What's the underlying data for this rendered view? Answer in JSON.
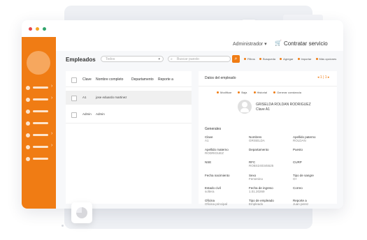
{
  "header": {
    "user": "Administrador",
    "cta": "Contratar servicio"
  },
  "sidebar": {
    "items": [
      {
        "icon": "nav-icon"
      },
      {
        "icon": "nav-icon"
      },
      {
        "icon": "nav-icon"
      },
      {
        "icon": "nav-icon"
      },
      {
        "icon": "nav-icon"
      },
      {
        "icon": "nav-icon"
      },
      {
        "icon": "nav-icon"
      }
    ]
  },
  "main": {
    "title": "Empleados",
    "filter_value": "Todos",
    "search_placeholder": "Buscar puesto",
    "actions": [
      "Filtros",
      "Busqueda",
      "Agregar",
      "Importar",
      "Más opciones"
    ]
  },
  "table": {
    "headers": [
      "Clave",
      "Nombre completo",
      "Departamento",
      "Reporte a"
    ],
    "rows": [
      {
        "clave": "A1",
        "nombre": "jose eduardo martinez",
        "departamento": "",
        "reporte": ""
      },
      {
        "clave": "Admin",
        "nombre": "Admin",
        "departamento": "",
        "reporte": ""
      }
    ]
  },
  "detail": {
    "title": "Datos del empleado",
    "pager": "1 | 1",
    "actions": [
      "Modificar",
      "Baja",
      "Historial",
      "Generar constancia"
    ],
    "name": "GRISELDA ROLDAN RODRIGUEZ",
    "clave": "Clave A1",
    "section": "Generales",
    "fields": [
      {
        "label": "Clave",
        "value": "A1"
      },
      {
        "label": "Nombres",
        "value": "GRISELDA"
      },
      {
        "label": "Apellido paterno",
        "value": "ROLDAN"
      },
      {
        "label": "Apellido materno",
        "value": "RODRIGUEZ"
      },
      {
        "label": "Departamento",
        "value": ""
      },
      {
        "label": "Puesto",
        "value": ""
      },
      {
        "label": "NSE",
        "value": ""
      },
      {
        "label": "RFC",
        "value": "ROBS240345525"
      },
      {
        "label": "CURP",
        "value": ""
      },
      {
        "label": "Fecha nacimiento",
        "value": ""
      },
      {
        "label": "Sexo",
        "value": "Femenino"
      },
      {
        "label": "Tipo de sangre",
        "value": "O+"
      },
      {
        "label": "Estado civil",
        "value": "soltera"
      },
      {
        "label": "Fecha de ingreso",
        "value": "1.01.20269"
      },
      {
        "label": "Correo",
        "value": ""
      },
      {
        "label": "Oficina",
        "value": "Oficina principal"
      },
      {
        "label": "Tipo de empleado",
        "value": "Empleado"
      },
      {
        "label": "Reporte a",
        "value": "Juan perez"
      }
    ]
  },
  "colors": {
    "accent": "#f07c14",
    "window_dots": [
      "#e5484d",
      "#f5a524",
      "#30a46c"
    ]
  }
}
